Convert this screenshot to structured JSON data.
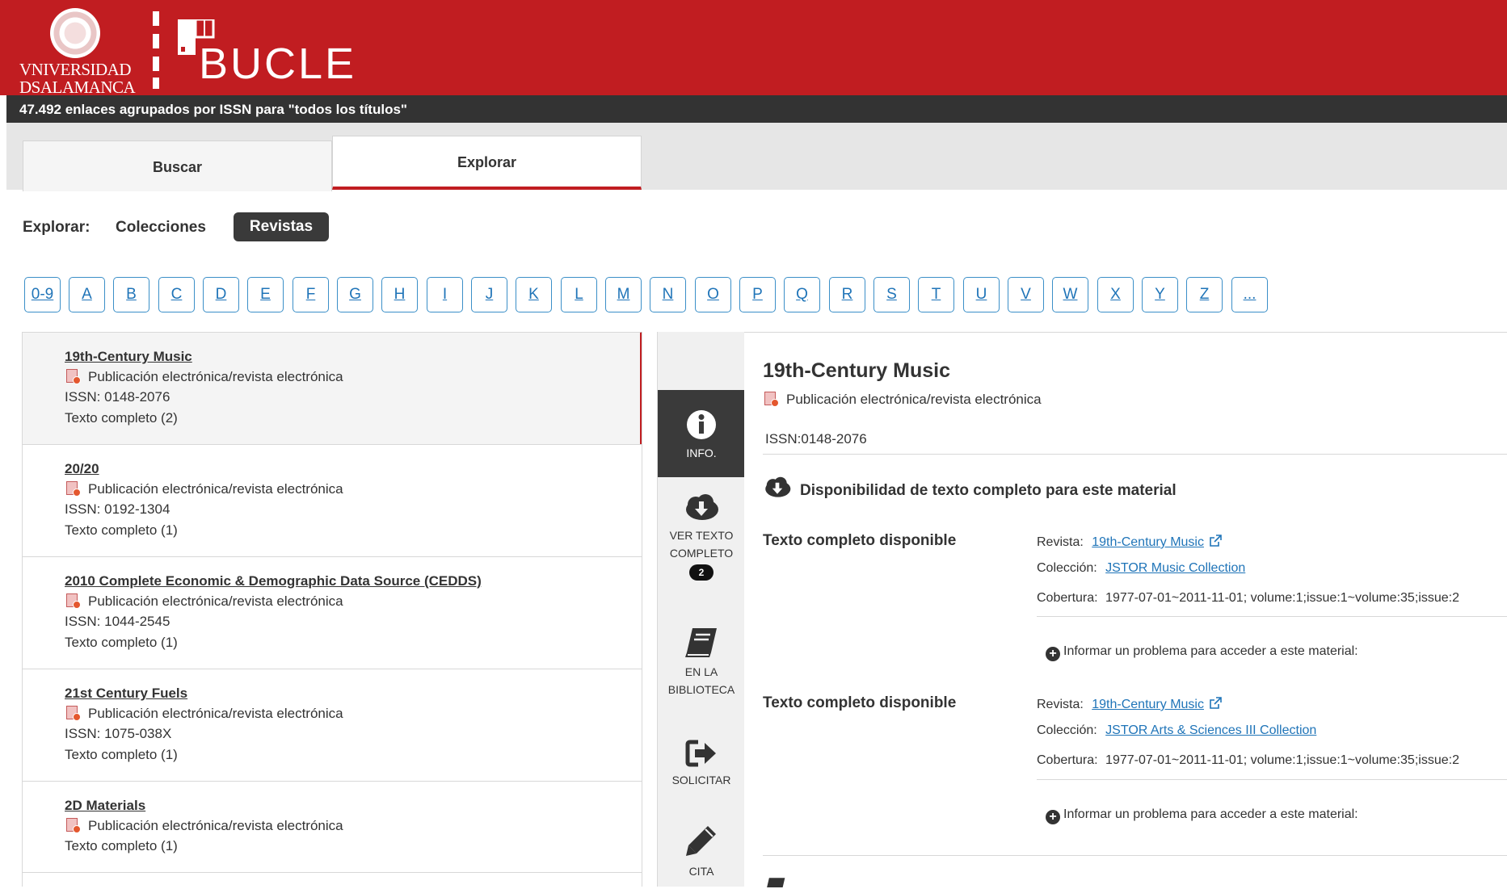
{
  "header": {
    "usal_line1": "VNIVERSIDAD",
    "usal_line2": "DSALAMANCA",
    "brand": "BUCLE",
    "subbar": "47.492 enlaces agrupados por ISSN para \"todos los títulos\""
  },
  "tabs": [
    {
      "label": "Buscar"
    },
    {
      "label": "Explorar"
    }
  ],
  "explore": {
    "label": "Explorar:",
    "collections": "Colecciones",
    "journals": "Revistas"
  },
  "letters": [
    "0-9",
    "A",
    "B",
    "C",
    "D",
    "E",
    "F",
    "G",
    "H",
    "I",
    "J",
    "K",
    "L",
    "M",
    "N",
    "O",
    "P",
    "Q",
    "R",
    "S",
    "T",
    "U",
    "V",
    "W",
    "X",
    "Y",
    "Z",
    "..."
  ],
  "list": {
    "items": [
      {
        "title": "19th-Century Music",
        "type": "Publicación electrónica/revista electrónica",
        "issn": "ISSN: 0148-2076",
        "texto": "Texto completo (2)"
      },
      {
        "title": "20/20",
        "type": "Publicación electrónica/revista electrónica",
        "issn": "ISSN: 0192-1304",
        "texto": "Texto completo (1)"
      },
      {
        "title": "2010 Complete Economic & Demographic Data Source (CEDDS)",
        "type": "Publicación electrónica/revista electrónica",
        "issn": "ISSN: 1044-2545",
        "texto": "Texto completo (1)"
      },
      {
        "title": "21st Century Fuels",
        "type": "Publicación electrónica/revista electrónica",
        "issn": "ISSN: 1075-038X",
        "texto": "Texto completo (1)"
      },
      {
        "title": "2D Materials",
        "type": "Publicación electrónica/revista electrónica",
        "texto": "Texto completo (1)"
      }
    ]
  },
  "sidenav": {
    "info": "INFO.",
    "ver_texto_1": "VER TEXTO",
    "ver_texto_2": "COMPLETO",
    "ver_texto_badge": "2",
    "biblioteca_1": "EN LA",
    "biblioteca_2": "BIBLIOTECA",
    "solicitar": "SOLICITAR",
    "cita": "CITA"
  },
  "detail": {
    "title": "19th-Century Music",
    "type": "Publicación electrónica/revista electrónica",
    "issn": "ISSN:0148-2076",
    "availability": "Disponibilidad de texto completo para este material",
    "blocks": [
      {
        "label": "Texto completo disponible",
        "revista_key": "Revista:",
        "revista": "19th-Century Music",
        "coleccion_key": "Colección:",
        "coleccion": "JSTOR Music Collection",
        "cobertura_key": "Cobertura:",
        "cobertura": "1977-07-01~2011-11-01; volume:1;issue:1~volume:35;issue:2",
        "problem": "Informar un problema para acceder a este material:"
      },
      {
        "label": "Texto completo disponible",
        "revista_key": "Revista:",
        "revista": "19th-Century Music",
        "coleccion_key": "Colección:",
        "coleccion": "JSTOR Arts & Sciences III Collection",
        "cobertura_key": "Cobertura:",
        "cobertura": "1977-07-01~2011-11-01; volume:1;issue:1~volume:35;issue:2",
        "problem": "Informar un problema para acceder a este material:"
      }
    ]
  },
  "colors": {
    "brand_red": "#c11d21",
    "dark_bar": "#333333",
    "link_blue": "#1f74b8"
  }
}
